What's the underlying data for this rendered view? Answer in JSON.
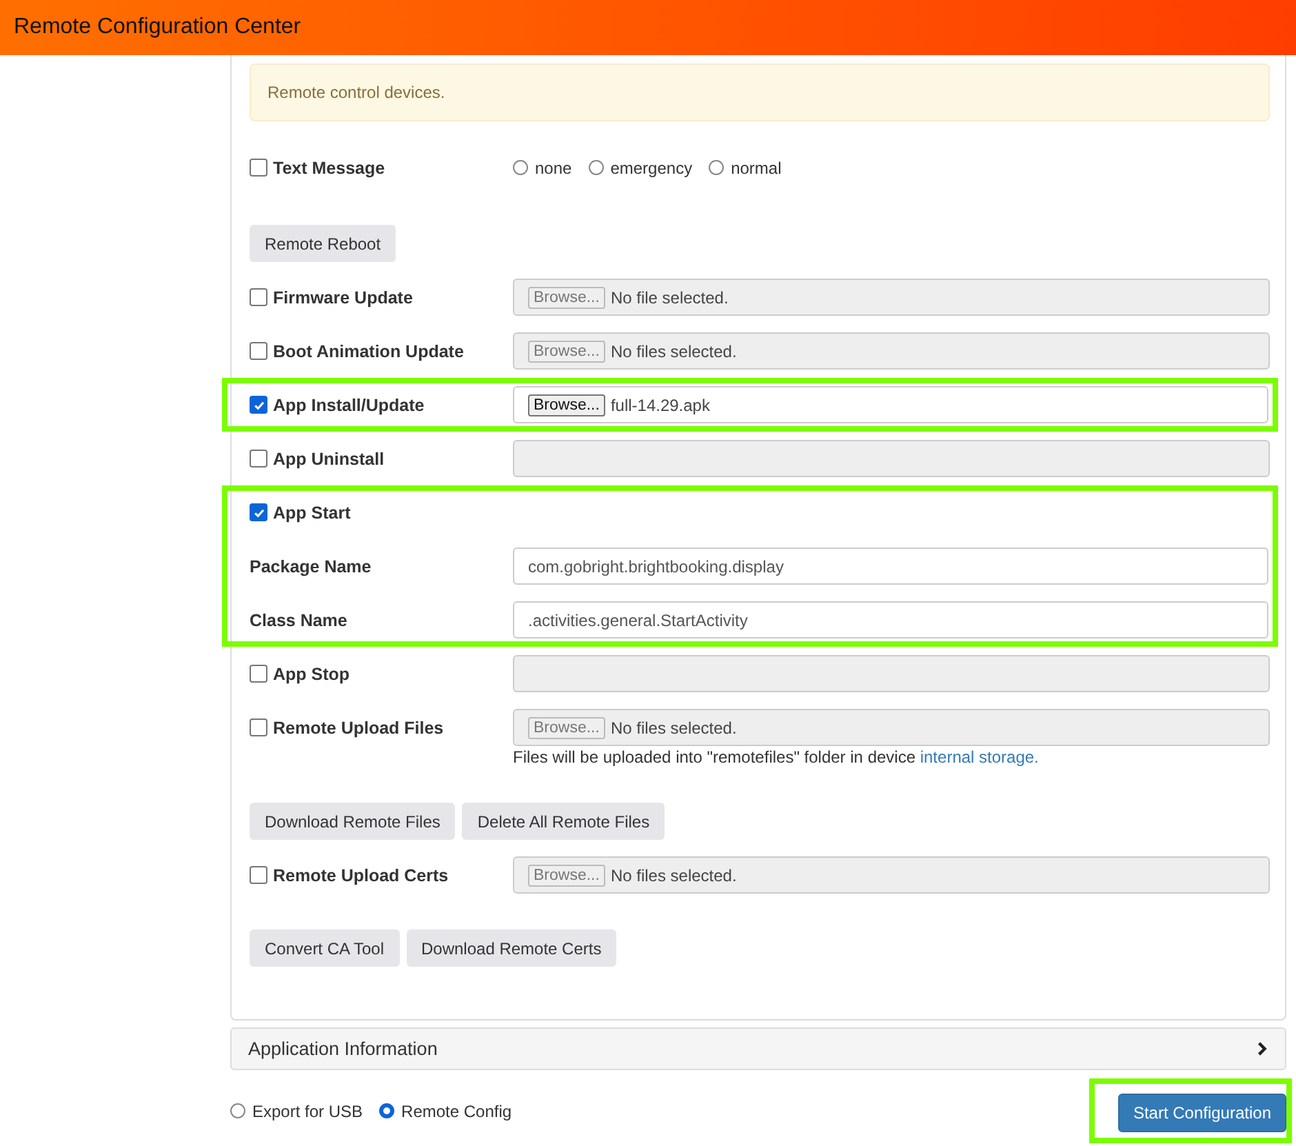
{
  "window": {
    "title": "Remote Configuration Center"
  },
  "alert": {
    "text": "Remote control devices."
  },
  "rows": [
    {
      "kind": "radios",
      "label": "Text Message",
      "checked": false,
      "highlighted": false,
      "options": [
        {
          "label": "none",
          "selected": false
        },
        {
          "label": "emergency",
          "selected": false
        },
        {
          "label": "normal",
          "selected": false
        }
      ]
    },
    {
      "kind": "buttons",
      "highlighted": false,
      "buttons": [
        "Remote Reboot"
      ]
    },
    {
      "kind": "file",
      "label": "Firmware Update",
      "checked": false,
      "highlighted": false,
      "disabled": true,
      "browse": "Browse...",
      "file": "No file selected."
    },
    {
      "kind": "file",
      "label": "Boot Animation Update",
      "checked": false,
      "highlighted": false,
      "disabled": true,
      "browse": "Browse...",
      "file": "No files selected."
    },
    {
      "kind": "file",
      "label": "App Install/Update",
      "checked": true,
      "highlighted": true,
      "disabled": false,
      "browse": "Browse...",
      "file": "full-14.29.apk"
    },
    {
      "kind": "empty",
      "label": "App Uninstall",
      "checked": false,
      "highlighted": false,
      "disabled": true
    },
    {
      "kind": "group",
      "label": "App Start",
      "checked": true,
      "highlighted": true,
      "fields": [
        {
          "label": "Package Name",
          "value": "com.gobright.brightbooking.display"
        },
        {
          "label": "Class Name",
          "value": ".activities.general.StartActivity"
        }
      ]
    },
    {
      "kind": "empty",
      "label": "App Stop",
      "checked": false,
      "highlighted": false,
      "disabled": true
    },
    {
      "kind": "file",
      "label": "Remote Upload Files",
      "checked": false,
      "highlighted": false,
      "disabled": true,
      "browse": "Browse...",
      "file": "No files selected.",
      "note": "Files will be uploaded into \"remotefiles\" folder in device",
      "link": "internal storage."
    },
    {
      "kind": "buttons",
      "highlighted": false,
      "buttons": [
        "Download Remote Files",
        "Delete All Remote Files"
      ]
    },
    {
      "kind": "file",
      "label": "Remote Upload Certs",
      "checked": false,
      "highlighted": false,
      "disabled": true,
      "browse": "Browse...",
      "file": "No files selected."
    },
    {
      "kind": "buttons",
      "highlighted": false,
      "buttons": [
        "Convert CA Tool",
        "Download Remote Certs"
      ]
    }
  ],
  "accordion": {
    "title": "Application Information",
    "expanded": false
  },
  "mode_options": [
    {
      "label": "Export for USB",
      "selected": false
    },
    {
      "label": "Remote Config",
      "selected": true
    }
  ],
  "start_button": {
    "label": "Start Configuration",
    "highlighted": true
  }
}
